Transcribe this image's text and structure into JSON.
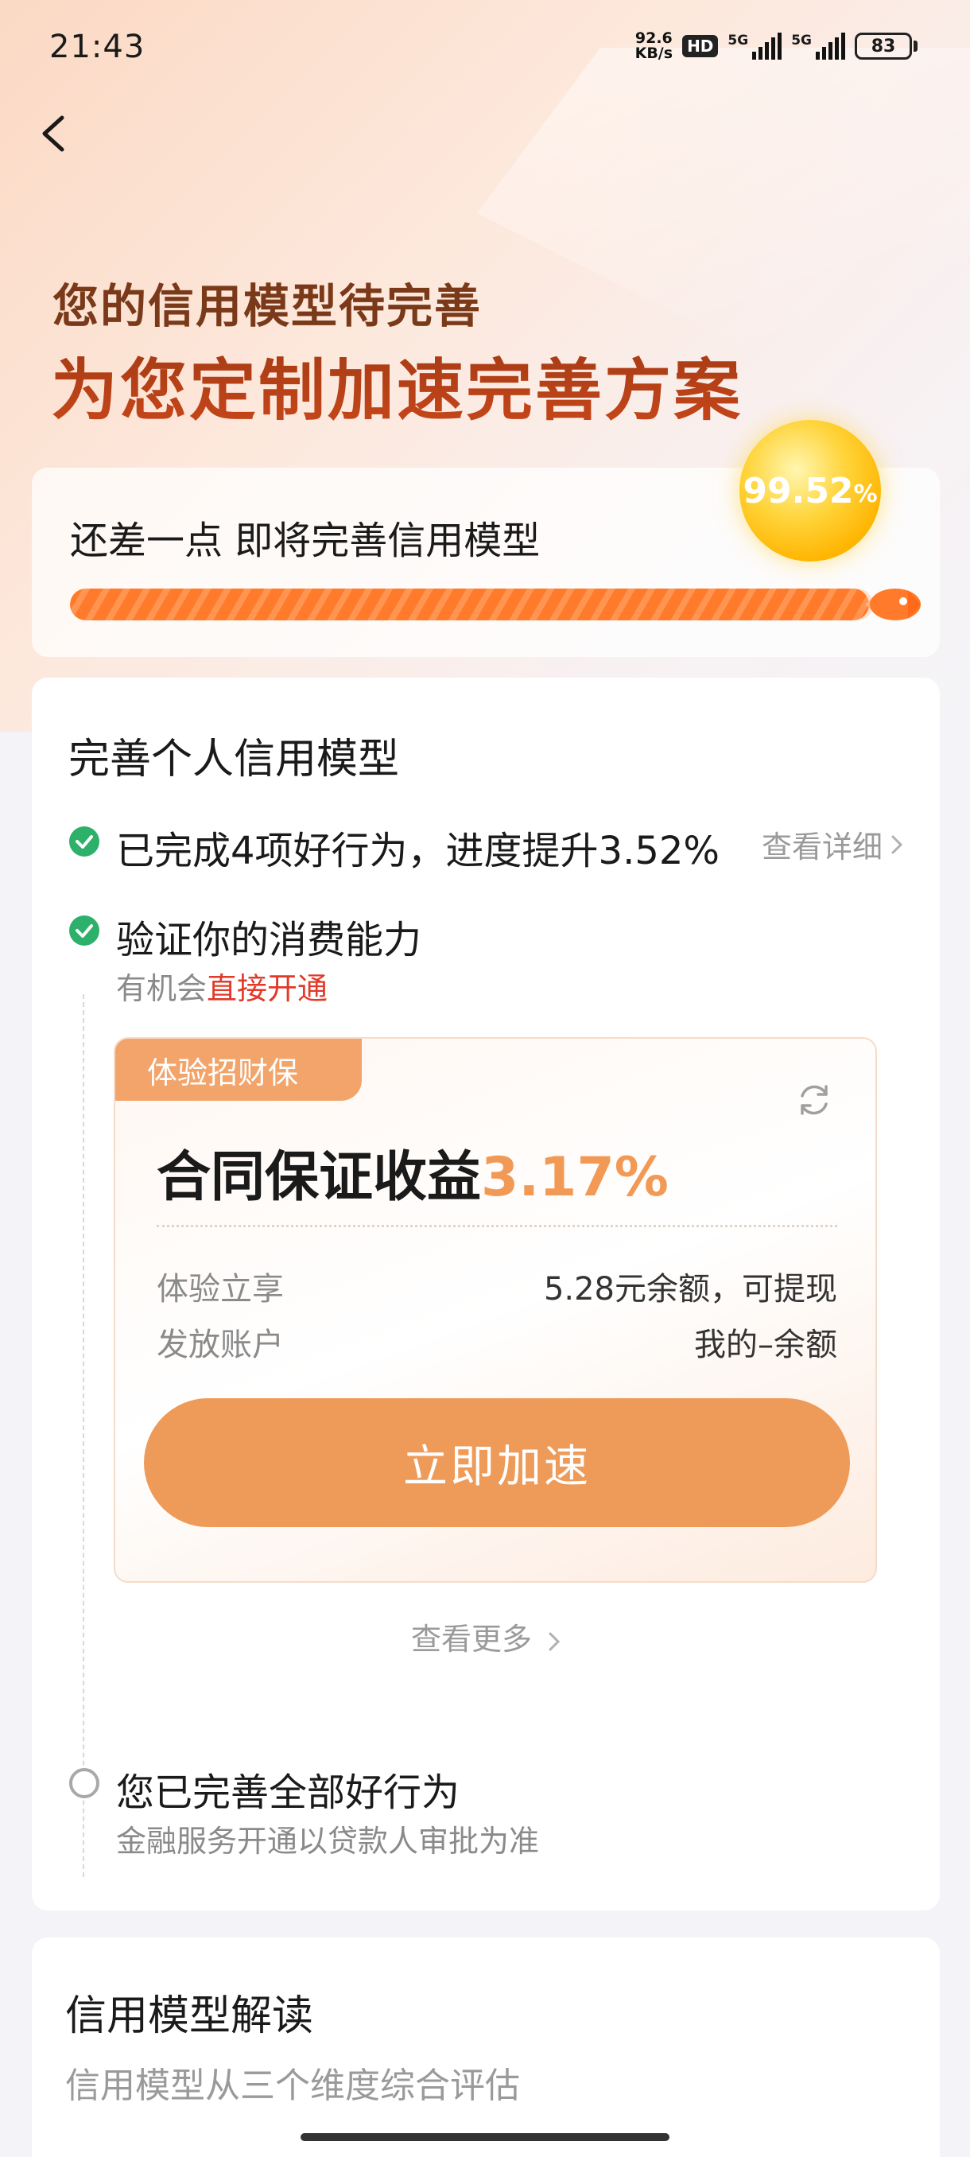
{
  "status_bar": {
    "time": "21:43",
    "net_speed_value": "92.6",
    "net_speed_unit": "KB/s",
    "hd_label": "HD",
    "signal1_label": "5G",
    "signal2_label": "5G",
    "battery": "83"
  },
  "hero": {
    "subtitle": "您的信用模型待完善",
    "title": "为您定制加速完善方案"
  },
  "progress": {
    "text": "还差一点 即将完善信用模型",
    "percent_num": "99.52",
    "percent_sign": "%",
    "fill_fraction": 0.9952
  },
  "main": {
    "section_title": "完善个人信用模型",
    "steps": [
      {
        "text": "已完成4项好行为，进度提升3.52%",
        "link": "查看详细",
        "status": "done"
      },
      {
        "text": "验证你的消费能力",
        "sub_prefix": "有机会",
        "sub_highlight": "直接开通",
        "status": "done"
      },
      {
        "text": "您已完善全部好行为",
        "sub": "金融服务开通以贷款人审批为准",
        "status": "pending"
      }
    ],
    "offer": {
      "tag": "体验招财保",
      "title_prefix": "合同保证收益",
      "rate": "3.17%",
      "rows": [
        {
          "k": "体验立享",
          "v": "5.28元余额，可提现"
        },
        {
          "k": "发放账户",
          "v": "我的–余额"
        }
      ],
      "cta": "立即加速"
    },
    "more": "查看更多"
  },
  "explain": {
    "title": "信用模型解读",
    "sub": "信用模型从三个维度综合评估"
  },
  "colors": {
    "accent": "#ee9a58",
    "check_green": "#2db06a",
    "highlight_red": "#e03a2a",
    "title_brown": "#8a2e10"
  }
}
